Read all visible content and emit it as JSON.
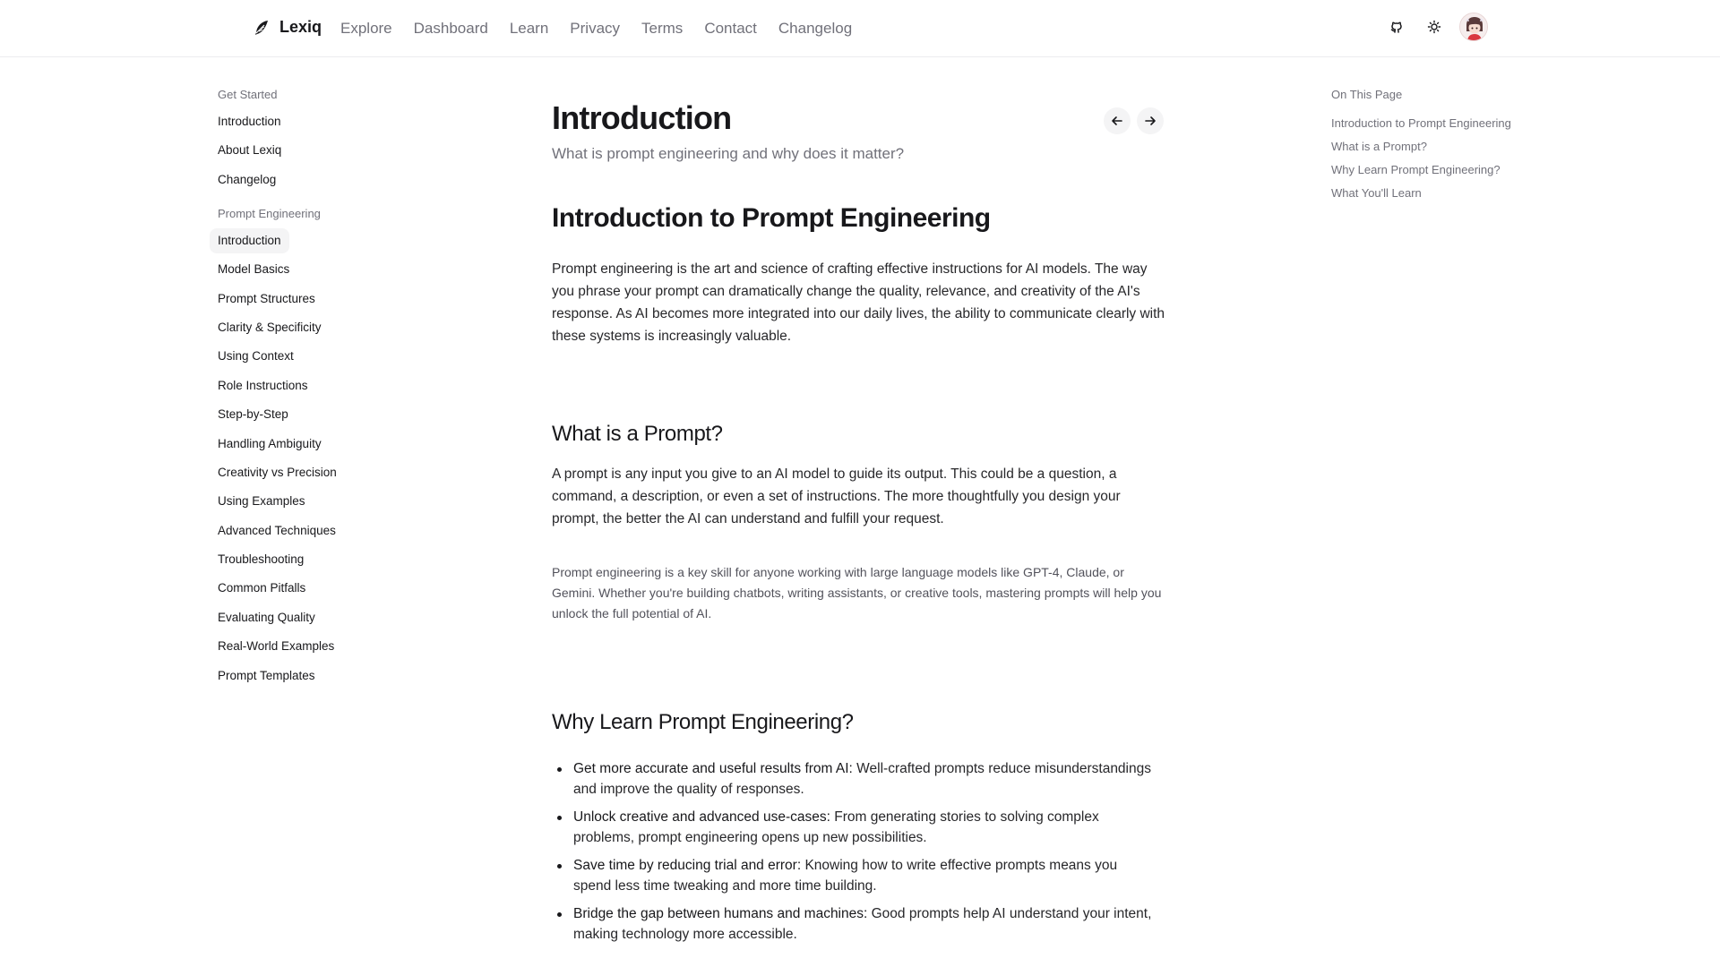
{
  "header": {
    "brand": "Lexiq",
    "nav": [
      "Explore",
      "Dashboard",
      "Learn",
      "Privacy",
      "Terms",
      "Contact",
      "Changelog"
    ],
    "icons": [
      "github-icon",
      "sun-icon",
      "avatar"
    ]
  },
  "sidebar": {
    "groups": [
      {
        "title": "Get Started",
        "items": [
          "Introduction",
          "About Lexiq",
          "Changelog"
        ]
      },
      {
        "title": "Prompt Engineering",
        "items": [
          "Introduction",
          "Model Basics",
          "Prompt Structures",
          "Clarity & Specificity",
          "Using Context",
          "Role Instructions",
          "Step-by-Step",
          "Handling Ambiguity",
          "Creativity vs Precision",
          "Using Examples",
          "Advanced Techniques",
          "Troubleshooting",
          "Common Pitfalls",
          "Evaluating Quality",
          "Real-World Examples",
          "Prompt Templates"
        ]
      }
    ],
    "active": "Introduction"
  },
  "main": {
    "title": "Introduction",
    "subtitle": "What is prompt engineering and why does it matter?",
    "h2": "Introduction to Prompt Engineering",
    "p1": "Prompt engineering is the art and science of crafting effective instructions for AI models. The way you phrase your prompt can dramatically change the quality, relevance, and creativity of the AI's response. As AI becomes more integrated into our daily lives, the ability to communicate clearly with these systems is increasingly valuable.",
    "h3a": "What is a Prompt?",
    "p2": "A prompt is any input you give to an AI model to guide its output. This could be a question, a command, a description, or even a set of instructions. The more thoughtfully you design your prompt, the better the AI can understand and fulfill your request.",
    "p3": "Prompt engineering is a key skill for anyone working with large language models like GPT-4, Claude, or Gemini. Whether you're building chatbots, writing assistants, or creative tools, mastering prompts will help you unlock the full potential of AI.",
    "h3b": "Why Learn Prompt Engineering?",
    "bullets": [
      {
        "bold": "Get more accurate and useful results from AI:",
        "text": " Well-crafted prompts reduce misunderstandings and improve the quality of responses."
      },
      {
        "bold": "Unlock creative and advanced use-cases:",
        "text": " From generating stories to solving complex problems, prompt engineering opens up new possibilities."
      },
      {
        "bold": "Save time by reducing trial and error:",
        "text": " Knowing how to write effective prompts means you spend less time tweaking and more time building."
      },
      {
        "bold": "Bridge the gap between humans and machines:",
        "text": " Good prompts help AI understand your intent, making technology more accessible."
      }
    ]
  },
  "toc": {
    "title": "On This Page",
    "items": [
      "Introduction to Prompt Engineering",
      "What is a Prompt?",
      "Why Learn Prompt Engineering?",
      "What You'll Learn"
    ]
  }
}
